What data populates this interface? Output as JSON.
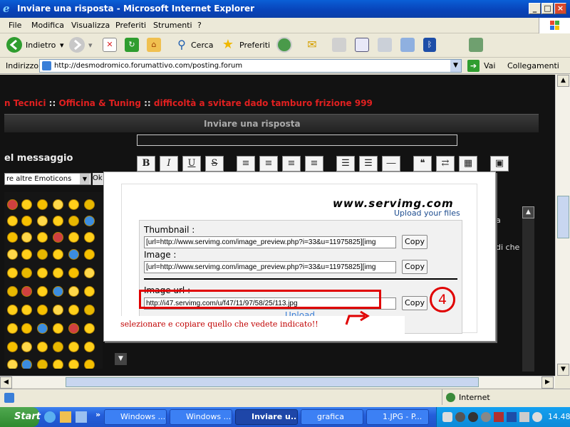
{
  "window": {
    "title": "Inviare una risposta - Microsoft Internet Explorer",
    "min": "_",
    "max": "□",
    "close": "×"
  },
  "menu": [
    "File",
    "Modifica",
    "Visualizza",
    "Preferiti",
    "Strumenti",
    "?"
  ],
  "toolbar": {
    "back": "Indietro",
    "search": "Cerca",
    "favorites": "Preferiti"
  },
  "address": {
    "label": "Indirizzo",
    "url": "http://desmodromico.forumattivo.com/posting.forum",
    "go": "Vai",
    "links": "Collegamenti"
  },
  "page": {
    "breadcrumb": {
      "part1": "n Tecnici",
      "part2": "Officina & Tuning",
      "part3": "difficoltà a svitare dado tamburo frizione 999",
      "sep": "::"
    },
    "reply_title": "Inviare una risposta",
    "msg_label": "el messaggio",
    "format_buttons": [
      "B",
      "I",
      "U",
      "S"
    ],
    "emoticon_select": "re altre Emoticons",
    "emoticon_ok": "Ok",
    "right_text_1": "a",
    "right_text_2": "di che"
  },
  "dialog": {
    "logo_text": "www.servimg.com",
    "logo_sub": "Upload your files",
    "thumb_label": "Thumbnail :",
    "thumb_value": "[url=http://www.servimg.com/image_preview.php?i=33&u=11975825][img",
    "image_label": "Image :",
    "image_value": "[url=http://www.servimg.com/image_preview.php?i=33&u=11975825][img",
    "url_label": "Image url :",
    "url_value": "http://i47.servimg.com/u/f47/11/97/58/25/113.jpg",
    "copy": "Copy",
    "upload": "Upload"
  },
  "annotation": {
    "step": "4",
    "instruction": "selezionare e copiare quello che vedete indicato!!",
    "color": "#e00000"
  },
  "status": {
    "zone": "Internet"
  },
  "taskbar": {
    "start": "Start",
    "tasks": [
      "Windows ...",
      "Windows ...",
      "Inviare u...",
      "grafica",
      "1.JPG - P..."
    ],
    "clock": "14.48"
  }
}
